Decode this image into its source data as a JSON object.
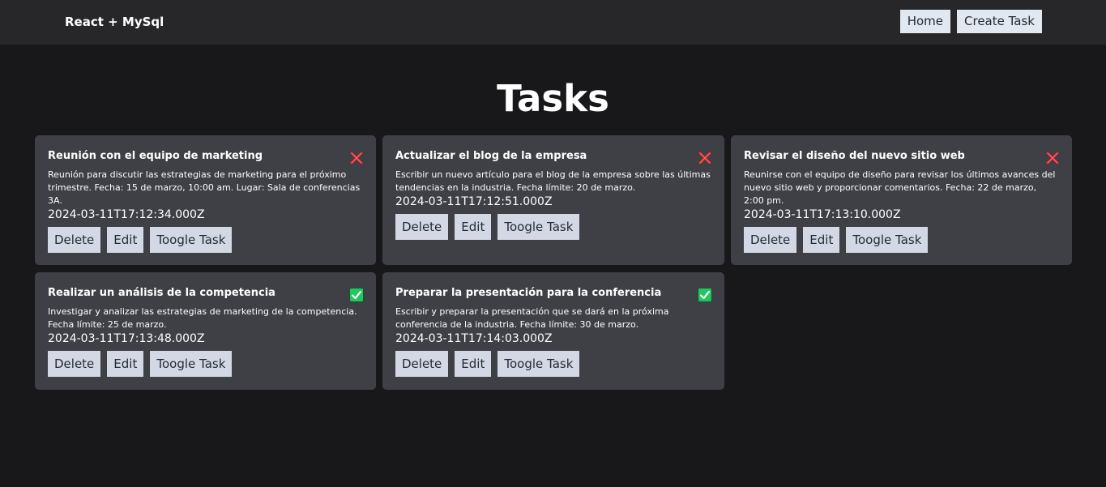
{
  "nav": {
    "brand": "React + MySql",
    "home_label": "Home",
    "create_label": "Create Task"
  },
  "page": {
    "title": "Tasks"
  },
  "actions": {
    "delete_label": "Delete",
    "edit_label": "Edit",
    "toggle_label": "Toogle Task"
  },
  "colors": {
    "background": "#18181b",
    "navbar": "#27272a",
    "card": "#3f3f46",
    "done": "#22c55e",
    "not_done": "#dc2626"
  },
  "tasks": [
    {
      "title": "Reunión con el equipo de marketing",
      "description": "Reunión para discutir las estrategias de marketing para el próximo trimestre. Fecha: 15 de marzo, 10:00 am. Lugar: Sala de conferencias 3A.",
      "created_at": "2024-03-11T17:12:34.000Z",
      "done": false,
      "status_icon": "cross-mark-icon"
    },
    {
      "title": "Actualizar el blog de la empresa",
      "description": "Escribir un nuevo artículo para el blog de la empresa sobre las últimas tendencias en la industria. Fecha límite: 20 de marzo.",
      "created_at": "2024-03-11T17:12:51.000Z",
      "done": false,
      "status_icon": "cross-mark-icon"
    },
    {
      "title": "Revisar el diseño del nuevo sitio web",
      "description": "Reunirse con el equipo de diseño para revisar los últimos avances del nuevo sitio web y proporcionar comentarios. Fecha: 22 de marzo, 2:00 pm.",
      "created_at": "2024-03-11T17:13:10.000Z",
      "done": false,
      "status_icon": "cross-mark-icon"
    },
    {
      "title": "Realizar un análisis de la competencia",
      "description": "Investigar y analizar las estrategias de marketing de la competencia. Fecha límite: 25 de marzo.",
      "created_at": "2024-03-11T17:13:48.000Z",
      "done": true,
      "status_icon": "check-mark-icon"
    },
    {
      "title": "Preparar la presentación para la conferencia",
      "description": "Escribir y preparar la presentación que se dará en la próxima conferencia de la industria. Fecha límite: 30 de marzo.",
      "created_at": "2024-03-11T17:14:03.000Z",
      "done": true,
      "status_icon": "check-mark-icon"
    }
  ]
}
